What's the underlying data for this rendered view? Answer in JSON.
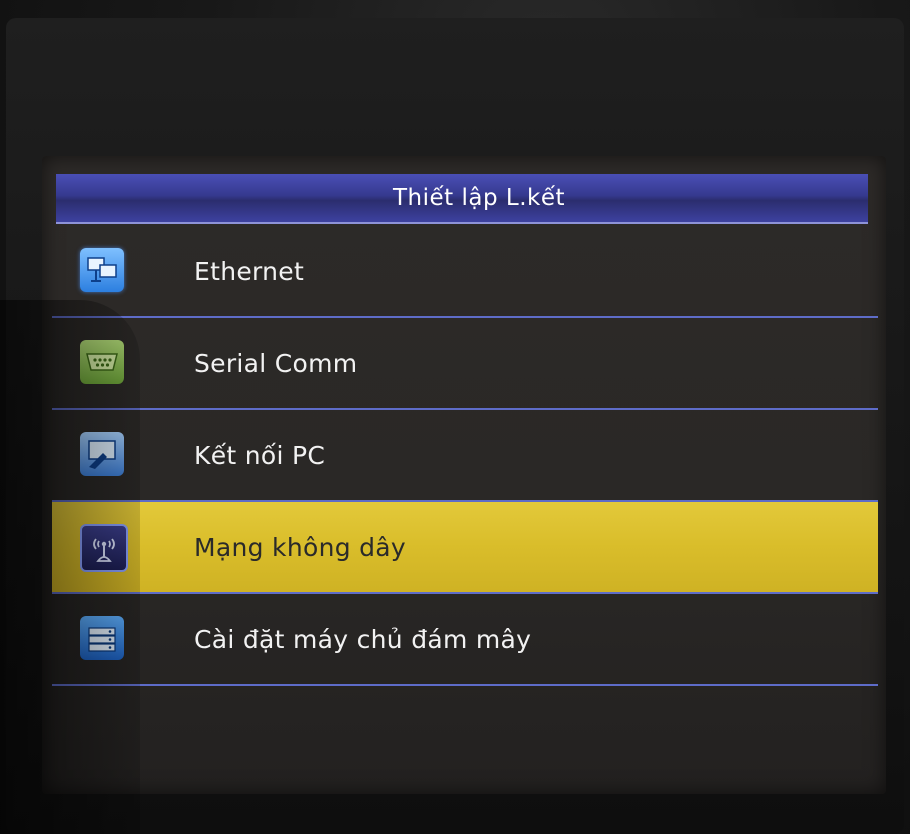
{
  "screen": {
    "title": "Thiết lập L.kết"
  },
  "menu": {
    "items": [
      {
        "label": "Ethernet",
        "icon": "ethernet-icon",
        "selected": false
      },
      {
        "label": "Serial Comm",
        "icon": "serial-port-icon",
        "selected": false
      },
      {
        "label": "Kết nối PC",
        "icon": "pc-connection-icon",
        "selected": false
      },
      {
        "label": "Mạng không dây",
        "icon": "wifi-icon",
        "selected": true
      },
      {
        "label": "Cài đặt máy chủ đám mây",
        "icon": "cloud-server-icon",
        "selected": false
      }
    ]
  },
  "colors": {
    "title_bar": "#35398e",
    "selected_row": "#d9bd2a",
    "divider": "#5e6cc8",
    "screen_bg": "#2a2826"
  }
}
